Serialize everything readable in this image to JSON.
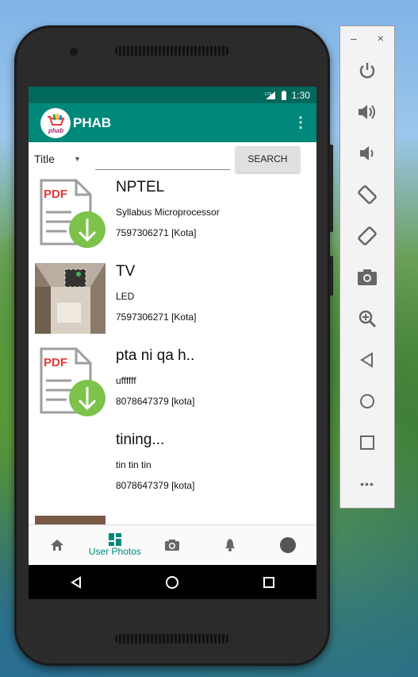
{
  "status": {
    "network": "LTE",
    "time": "1:30"
  },
  "app": {
    "title": "PHAB",
    "logo_text": "phab",
    "overflow": "⋮"
  },
  "search": {
    "filter": "Title",
    "value": "",
    "button": "SEARCH"
  },
  "items": [
    {
      "title": "NPTEL",
      "desc": "Syllabus Microprocessor",
      "contact": "7597306271 [Kota]",
      "thumb": "pdf-icon"
    },
    {
      "title": "TV",
      "desc": "LED",
      "contact": "7597306271 [Kota]",
      "thumb": "photo"
    },
    {
      "title": "pta ni qa h..",
      "desc": "uffffff",
      "contact": "8078647379 [kota]",
      "thumb": "pdf-icon"
    },
    {
      "title": "tining...",
      "desc": "tin tin tin",
      "contact": "8078647379 [kota]",
      "thumb": "none"
    }
  ],
  "bottom_nav": {
    "active_label": "User Photos"
  },
  "colors": {
    "primary": "#00897b",
    "primary_dark": "#00695c",
    "download": "#7cc24b",
    "pdf_red": "#e53935"
  },
  "emulator": {
    "minimize": "–",
    "close": "×",
    "more": "•••"
  }
}
